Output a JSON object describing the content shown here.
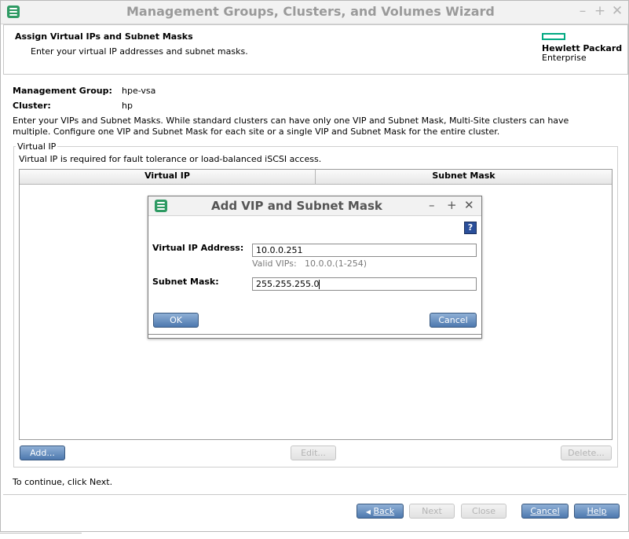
{
  "window": {
    "title": "Management Groups, Clusters, and Volumes Wizard",
    "controls": [
      "–",
      "+",
      "✕"
    ]
  },
  "header": {
    "heading": "Assign Virtual IPs and Subnet Masks",
    "subheading": "Enter your virtual IP addresses and subnet masks.",
    "logo_line1": "Hewlett Packard",
    "logo_line2": "Enterprise",
    "logo_color": "#01a982"
  },
  "info": {
    "mg_label": "Management Group:",
    "mg_value": "hpe-vsa",
    "cluster_label": "Cluster:",
    "cluster_value": "hp",
    "desc_line1": "Enter your VIPs and Subnet Masks. While standard clusters can have only one VIP and Subnet Mask, Multi-Site clusters can have",
    "desc_line2": "multiple. Configure one VIP and Subnet Mask for each site or a single VIP and Subnet Mask for the entire cluster."
  },
  "vip_group": {
    "legend": "Virtual IP",
    "note": "Virtual IP is required for fault tolerance or load-balanced iSCSI access.",
    "columns": [
      "Virtual IP",
      "Subnet Mask"
    ],
    "add_label": "Add...",
    "edit_label": "Edit...",
    "delete_label": "Delete..."
  },
  "footer": {
    "continue_text": "To continue, click Next.",
    "back_label": "Back",
    "next_label": "Next",
    "close_label": "Close",
    "cancel_label": "Cancel",
    "help_label": "Help"
  },
  "dialog": {
    "title": "Add VIP and Subnet Mask",
    "controls": [
      "–",
      "+",
      "✕"
    ],
    "help_glyph": "?",
    "vip_label": "Virtual IP Address:",
    "vip_value": "10.0.0.251",
    "valid_label": "Valid VIPs:",
    "valid_value": "10.0.0.(1-254)",
    "mask_label": "Subnet Mask:",
    "mask_value": "255.255.255.0",
    "ok_label": "OK",
    "cancel_label": "Cancel"
  },
  "colors": {
    "app_icon": "#2e9a63",
    "primary_button": "#4d78ae",
    "help_icon": "#2a4f9a"
  }
}
